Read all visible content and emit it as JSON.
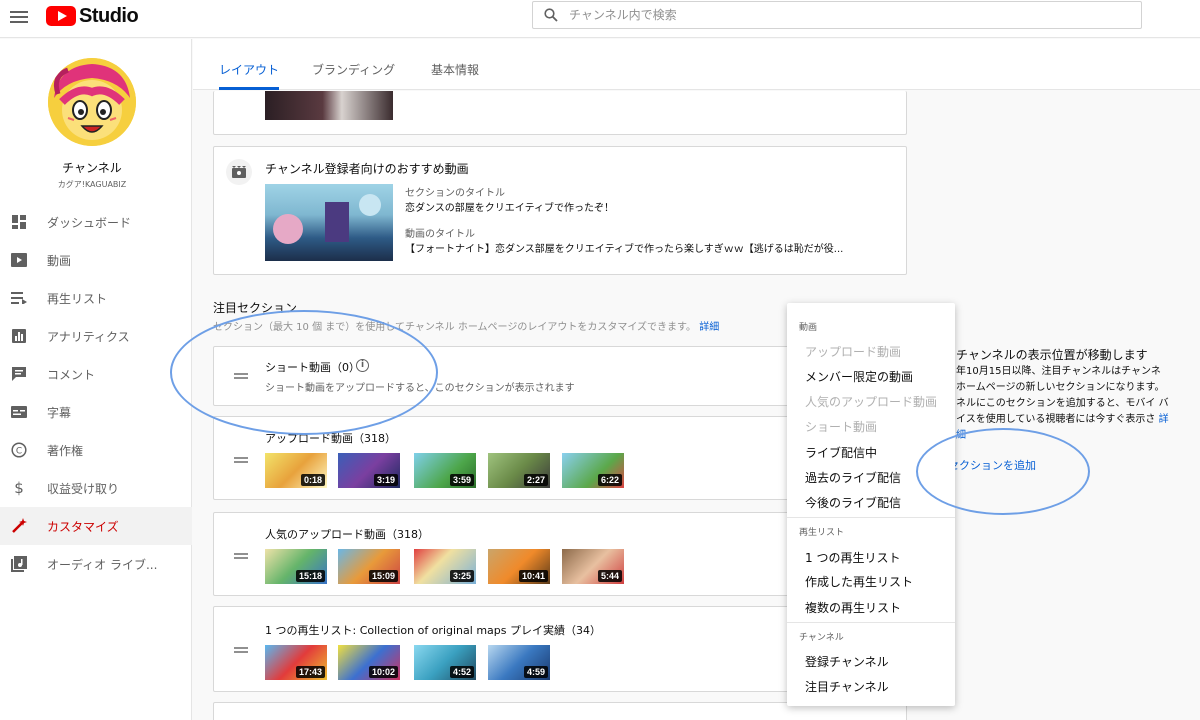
{
  "app": {
    "name": "Studio"
  },
  "search": {
    "placeholder": "チャンネル内で検索"
  },
  "channel": {
    "name": "チャンネル",
    "handle": "カグア!KAGUABIZ"
  },
  "sidebar": {
    "items": [
      {
        "label": "ダッシュボード",
        "icon": "dashboard-icon"
      },
      {
        "label": "動画",
        "icon": "video-icon"
      },
      {
        "label": "再生リスト",
        "icon": "playlist-icon"
      },
      {
        "label": "アナリティクス",
        "icon": "analytics-icon"
      },
      {
        "label": "コメント",
        "icon": "comment-icon"
      },
      {
        "label": "字幕",
        "icon": "subtitle-icon"
      },
      {
        "label": "著作権",
        "icon": "copyright-icon"
      },
      {
        "label": "収益受け取り",
        "icon": "dollar-icon"
      },
      {
        "label": "カスタマイズ",
        "icon": "magic-wand-icon",
        "active": true
      },
      {
        "label": "オーディオ ライブ...",
        "icon": "audio-library-icon"
      }
    ]
  },
  "tabs": [
    {
      "label": "レイアウト",
      "active": true
    },
    {
      "label": "ブランディング"
    },
    {
      "label": "基本情報"
    }
  ],
  "subscriber_card": {
    "title": "チャンネル登録者向けのおすすめ動画",
    "section_title_label": "セクションのタイトル",
    "section_title_value": "恋ダンスの部屋をクリエイティブで作ったぞ！",
    "video_title_label": "動画のタイトル",
    "video_title_value": "【フォートナイト】恋ダンス部屋をクリエイティブで作ったら楽しすぎｗｗ【逃げるは恥だが役..."
  },
  "featured": {
    "heading": "注目セクション",
    "subtext": "セクション（最大 10 個 まで）を使用してチャンネル ホームページのレイアウトをカスタマイズできます。",
    "details_link": "詳細"
  },
  "sections": [
    {
      "title": "ショート動画（0）",
      "empty_text": "ショート動画をアップロードすると、このセクションが表示されます"
    },
    {
      "title": "アップロード動画（318）",
      "durations": [
        "0:18",
        "3:19",
        "3:59",
        "2:27",
        "6:22"
      ]
    },
    {
      "title": "人気のアップロード動画（318）",
      "durations": [
        "15:18",
        "15:09",
        "3:25",
        "10:41",
        "5:44"
      ]
    },
    {
      "title": "1 つの再生リスト: Collection of original maps プレイ実績（34）",
      "durations": [
        "17:43",
        "10:02",
        "4:52",
        "4:59"
      ]
    }
  ],
  "menu": {
    "groups": [
      {
        "label": "動画",
        "items": [
          {
            "label": "アップロード動画",
            "disabled": true
          },
          {
            "label": "メンバー限定の動画"
          },
          {
            "label": "人気のアップロード動画",
            "disabled": true
          },
          {
            "label": "ショート動画",
            "disabled": true
          },
          {
            "label": "ライブ配信中"
          },
          {
            "label": "過去のライブ配信"
          },
          {
            "label": "今後のライブ配信"
          }
        ]
      },
      {
        "label": "再生リスト",
        "items": [
          {
            "label": "1 つの再生リスト"
          },
          {
            "label": "作成した再生リスト"
          },
          {
            "label": "複数の再生リスト"
          }
        ]
      },
      {
        "label": "チャンネル",
        "items": [
          {
            "label": "登録チャンネル"
          },
          {
            "label": "注目チャンネル"
          }
        ]
      }
    ]
  },
  "notice": {
    "title": "チャンネルの表示位置が移動します",
    "body": "年10月15日以降、注目チャンネルはチャンネ ホームページの新しいセクションになります。 ネルにこのセクションを追加すると、モバイ バイスを使用している視聴者には今すぐ表示さ",
    "details_link": "詳細"
  },
  "add_section_label": "セクションを追加",
  "colors": {
    "accent": "#065fd4",
    "brand_red": "#ff0000",
    "active_nav": "#cc0000",
    "annotation": "#6e9fe6"
  }
}
